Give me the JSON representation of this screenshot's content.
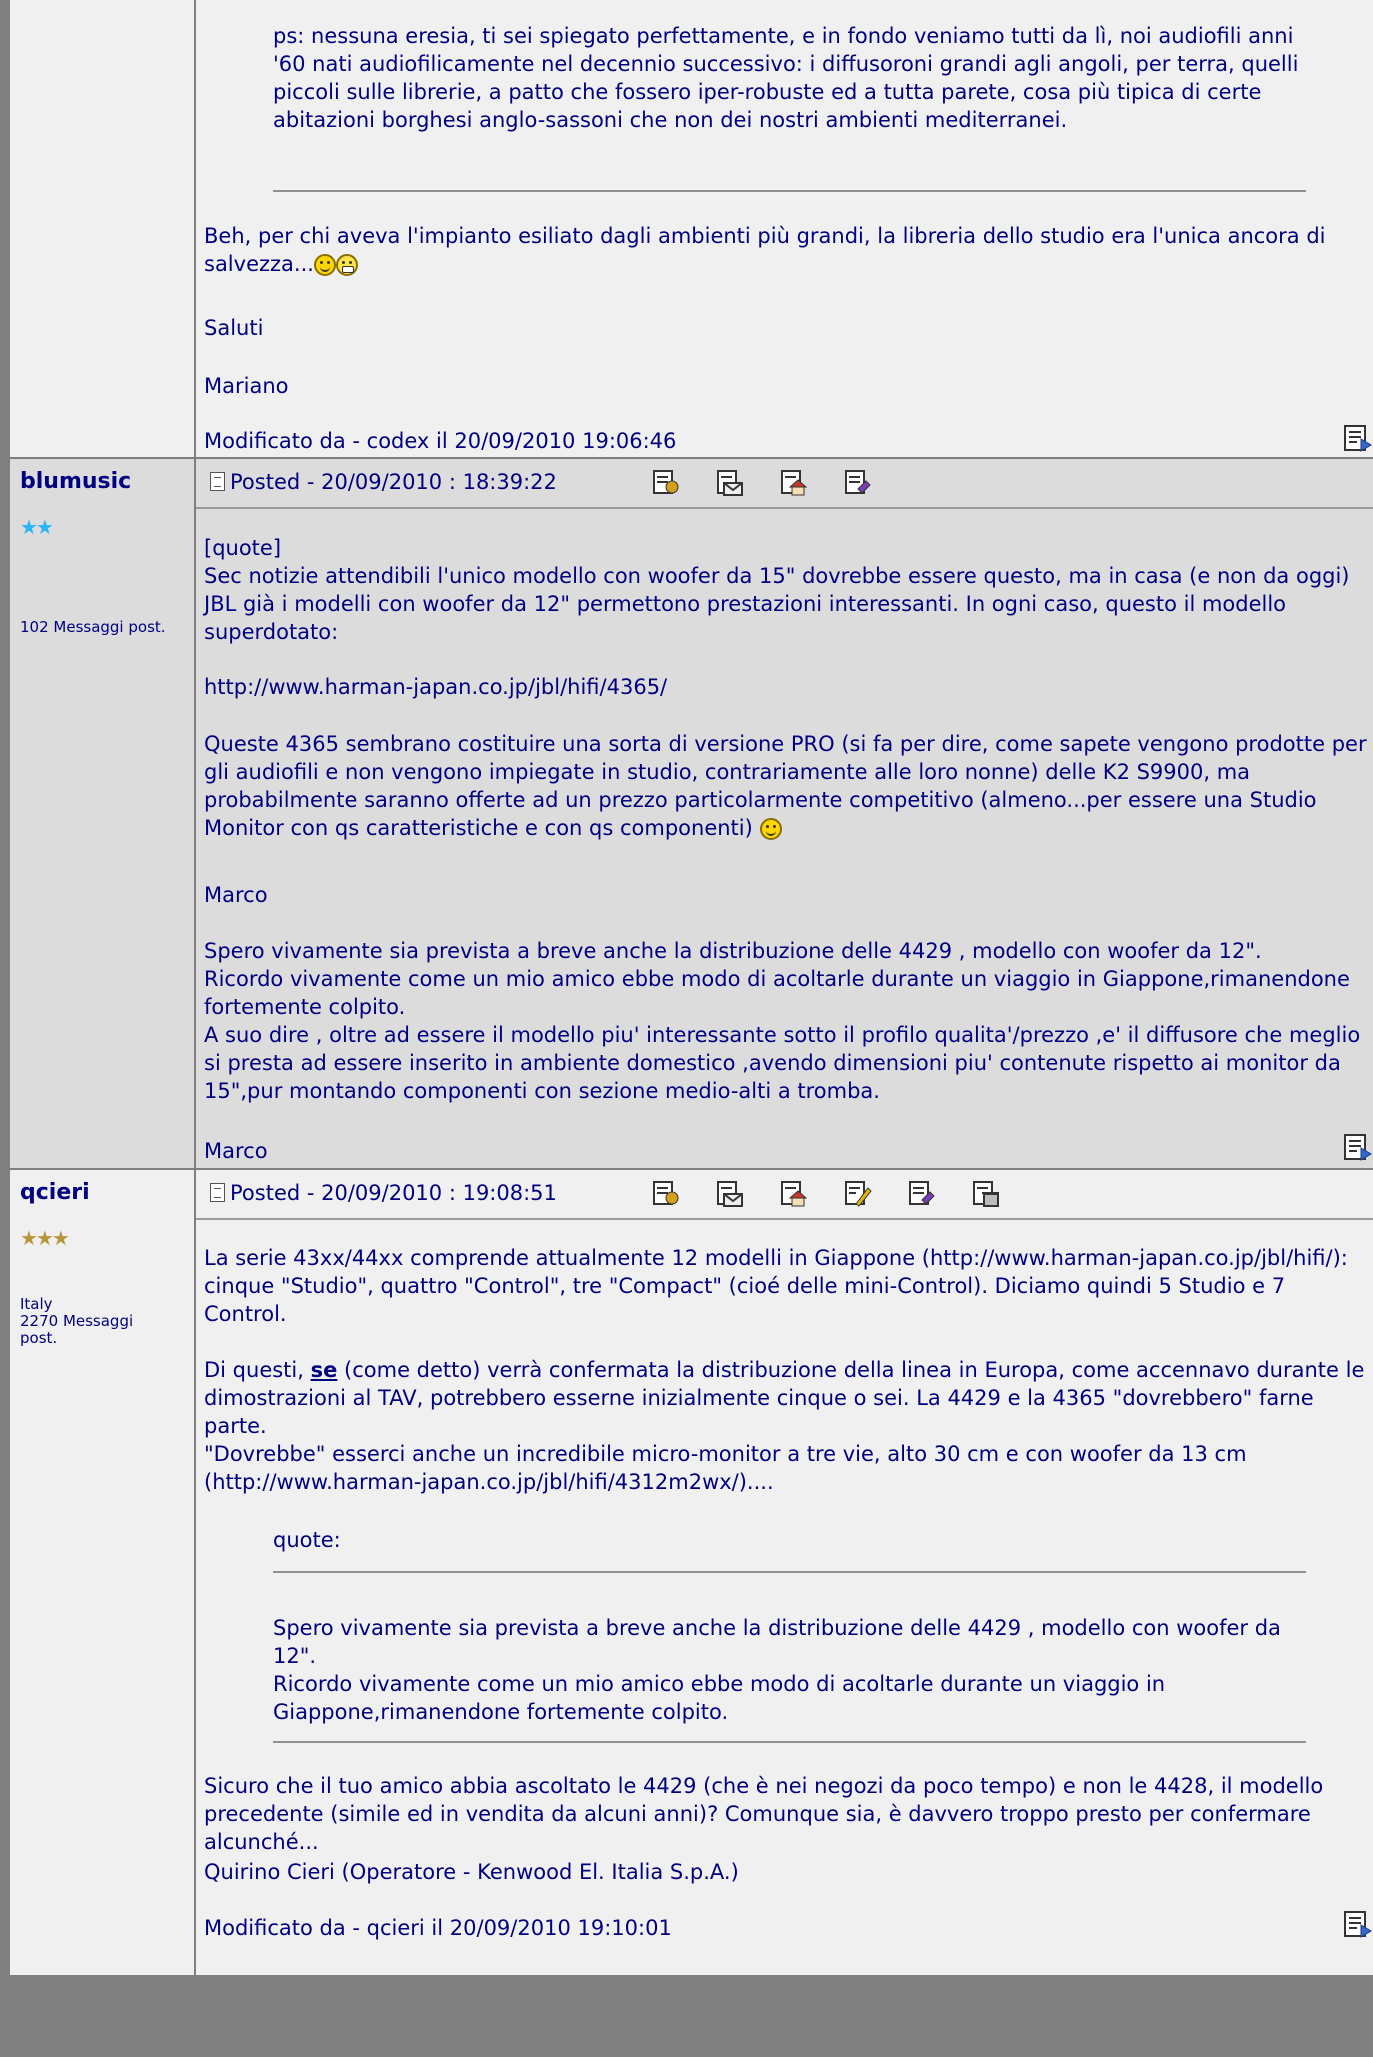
{
  "post1": {
    "quote_text": "ps: nessuna eresia, ti sei spiegato perfettamente, e in fondo veniamo tutti da lì, noi audiofili anni '60 nati audiofilicamente nel decennio successivo: i diffusoroni grandi agli angoli, per terra, quelli piccoli sulle librerie, a patto che fossero iper-robuste ed a tutta parete, cosa più tipica di certe abitazioni borghesi anglo-sassoni che non dei nostri ambienti mediterranei.",
    "body_line1": "Beh, per chi aveva l'impianto esiliato dagli ambienti più grandi, la libreria dello studio era l'unica ancora di salvezza...",
    "greeting": "Saluti",
    "signature": "Mariano",
    "edited": "Modificato da - codex il 20/09/2010 19:06:46"
  },
  "post2": {
    "username": "blumusic",
    "stars": "★★",
    "star_color": "#29b6f6",
    "posts_count": "102 Messaggi post.",
    "posted": "Posted - 20/09/2010 :  18:39:22",
    "quote_open": "[quote]",
    "para1": "Sec notizie attendibili l'unico modello con woofer da 15\" dovrebbe essere questo, ma in casa (e non da oggi) JBL già i modelli con woofer da 12\" permettono prestazioni interessanti. In ogni caso, questo il modello superdotato:",
    "link": "http://www.harman-japan.co.jp/jbl/hifi/4365/",
    "para2": "Queste 4365 sembrano costituire una sorta di versione PRO (si fa per dire, come sapete vengono prodotte per gli audiofili e non vengono impiegate in studio, contrariamente alle loro nonne) delle K2 S9900, ma probabilmente saranno offerte ad un prezzo particolarmente competitivo (almeno...per essere una Studio Monitor con qs caratteristiche e con qs componenti)",
    "sig1": "Marco",
    "para3": "Spero vivamente sia prevista a breve anche la distribuzione delle 4429 , modello con woofer da 12\".",
    "para3b": "Ricordo vivamente come un mio amico ebbe modo di acoltarle durante un viaggio in Giappone,rimanendone fortemente colpito.",
    "para3c": "A suo dire , oltre ad essere il modello piu' interessante sotto il profilo qualita'/prezzo ,e' il diffusore che meglio si presta ad essere inserito in ambiente domestico ,avendo dimensioni piu' contenute rispetto ai monitor da 15\",pur montando componenti con sezione medio-alti a tromba.",
    "sig2": "Marco"
  },
  "post3": {
    "username": "qcieri",
    "stars": "★★★",
    "star_color": "#b8963e",
    "country": "Italy",
    "posts_count": "2270 Messaggi post.",
    "posted": "Posted - 20/09/2010 :  19:08:51",
    "para1": "La serie 43xx/44xx comprende attualmente 12 modelli in Giappone (http://www.harman-japan.co.jp/jbl/hifi/): cinque \"Studio\", quattro \"Control\", tre \"Compact\" (cioé delle mini-Control). Diciamo quindi 5 Studio e 7 Control.",
    "para2_pre": "Di questi, ",
    "para2_se": "se",
    "para2_post": " (come detto) verrà confermata la distribuzione della linea in Europa, come accennavo durante le dimostrazioni al TAV, potrebbero esserne inizialmente cinque o sei. La 4429 e la 4365 \"dovrebbero\" farne parte.",
    "para2b": "\"Dovrebbe\" esserci anche un incredibile micro-monitor a tre vie, alto 30 cm e con woofer da 13 cm (http://www.harman-japan.co.jp/jbl/hifi/4312m2wx/)....",
    "quote_label": "quote:",
    "quote_body1": "Spero vivamente sia prevista a breve anche la distribuzione delle 4429 , modello con woofer da 12\".",
    "quote_body2": "Ricordo vivamente come un mio amico ebbe modo di acoltarle durante un viaggio in Giappone,rimanendone fortemente colpito.",
    "para3": "Sicuro che il tuo amico abbia ascoltato le 4429 (che è nei negozi da poco tempo) e non le 4428, il modello precedente (simile ed in vendita da alcuni anni)? Comunque sia, è davvero troppo presto per confermare alcunché...",
    "signature": "Quirino Cieri (Operatore - Kenwood El. Italia S.p.A.)",
    "edited": "Modificato da - qcieri il 20/09/2010 19:10:01"
  }
}
